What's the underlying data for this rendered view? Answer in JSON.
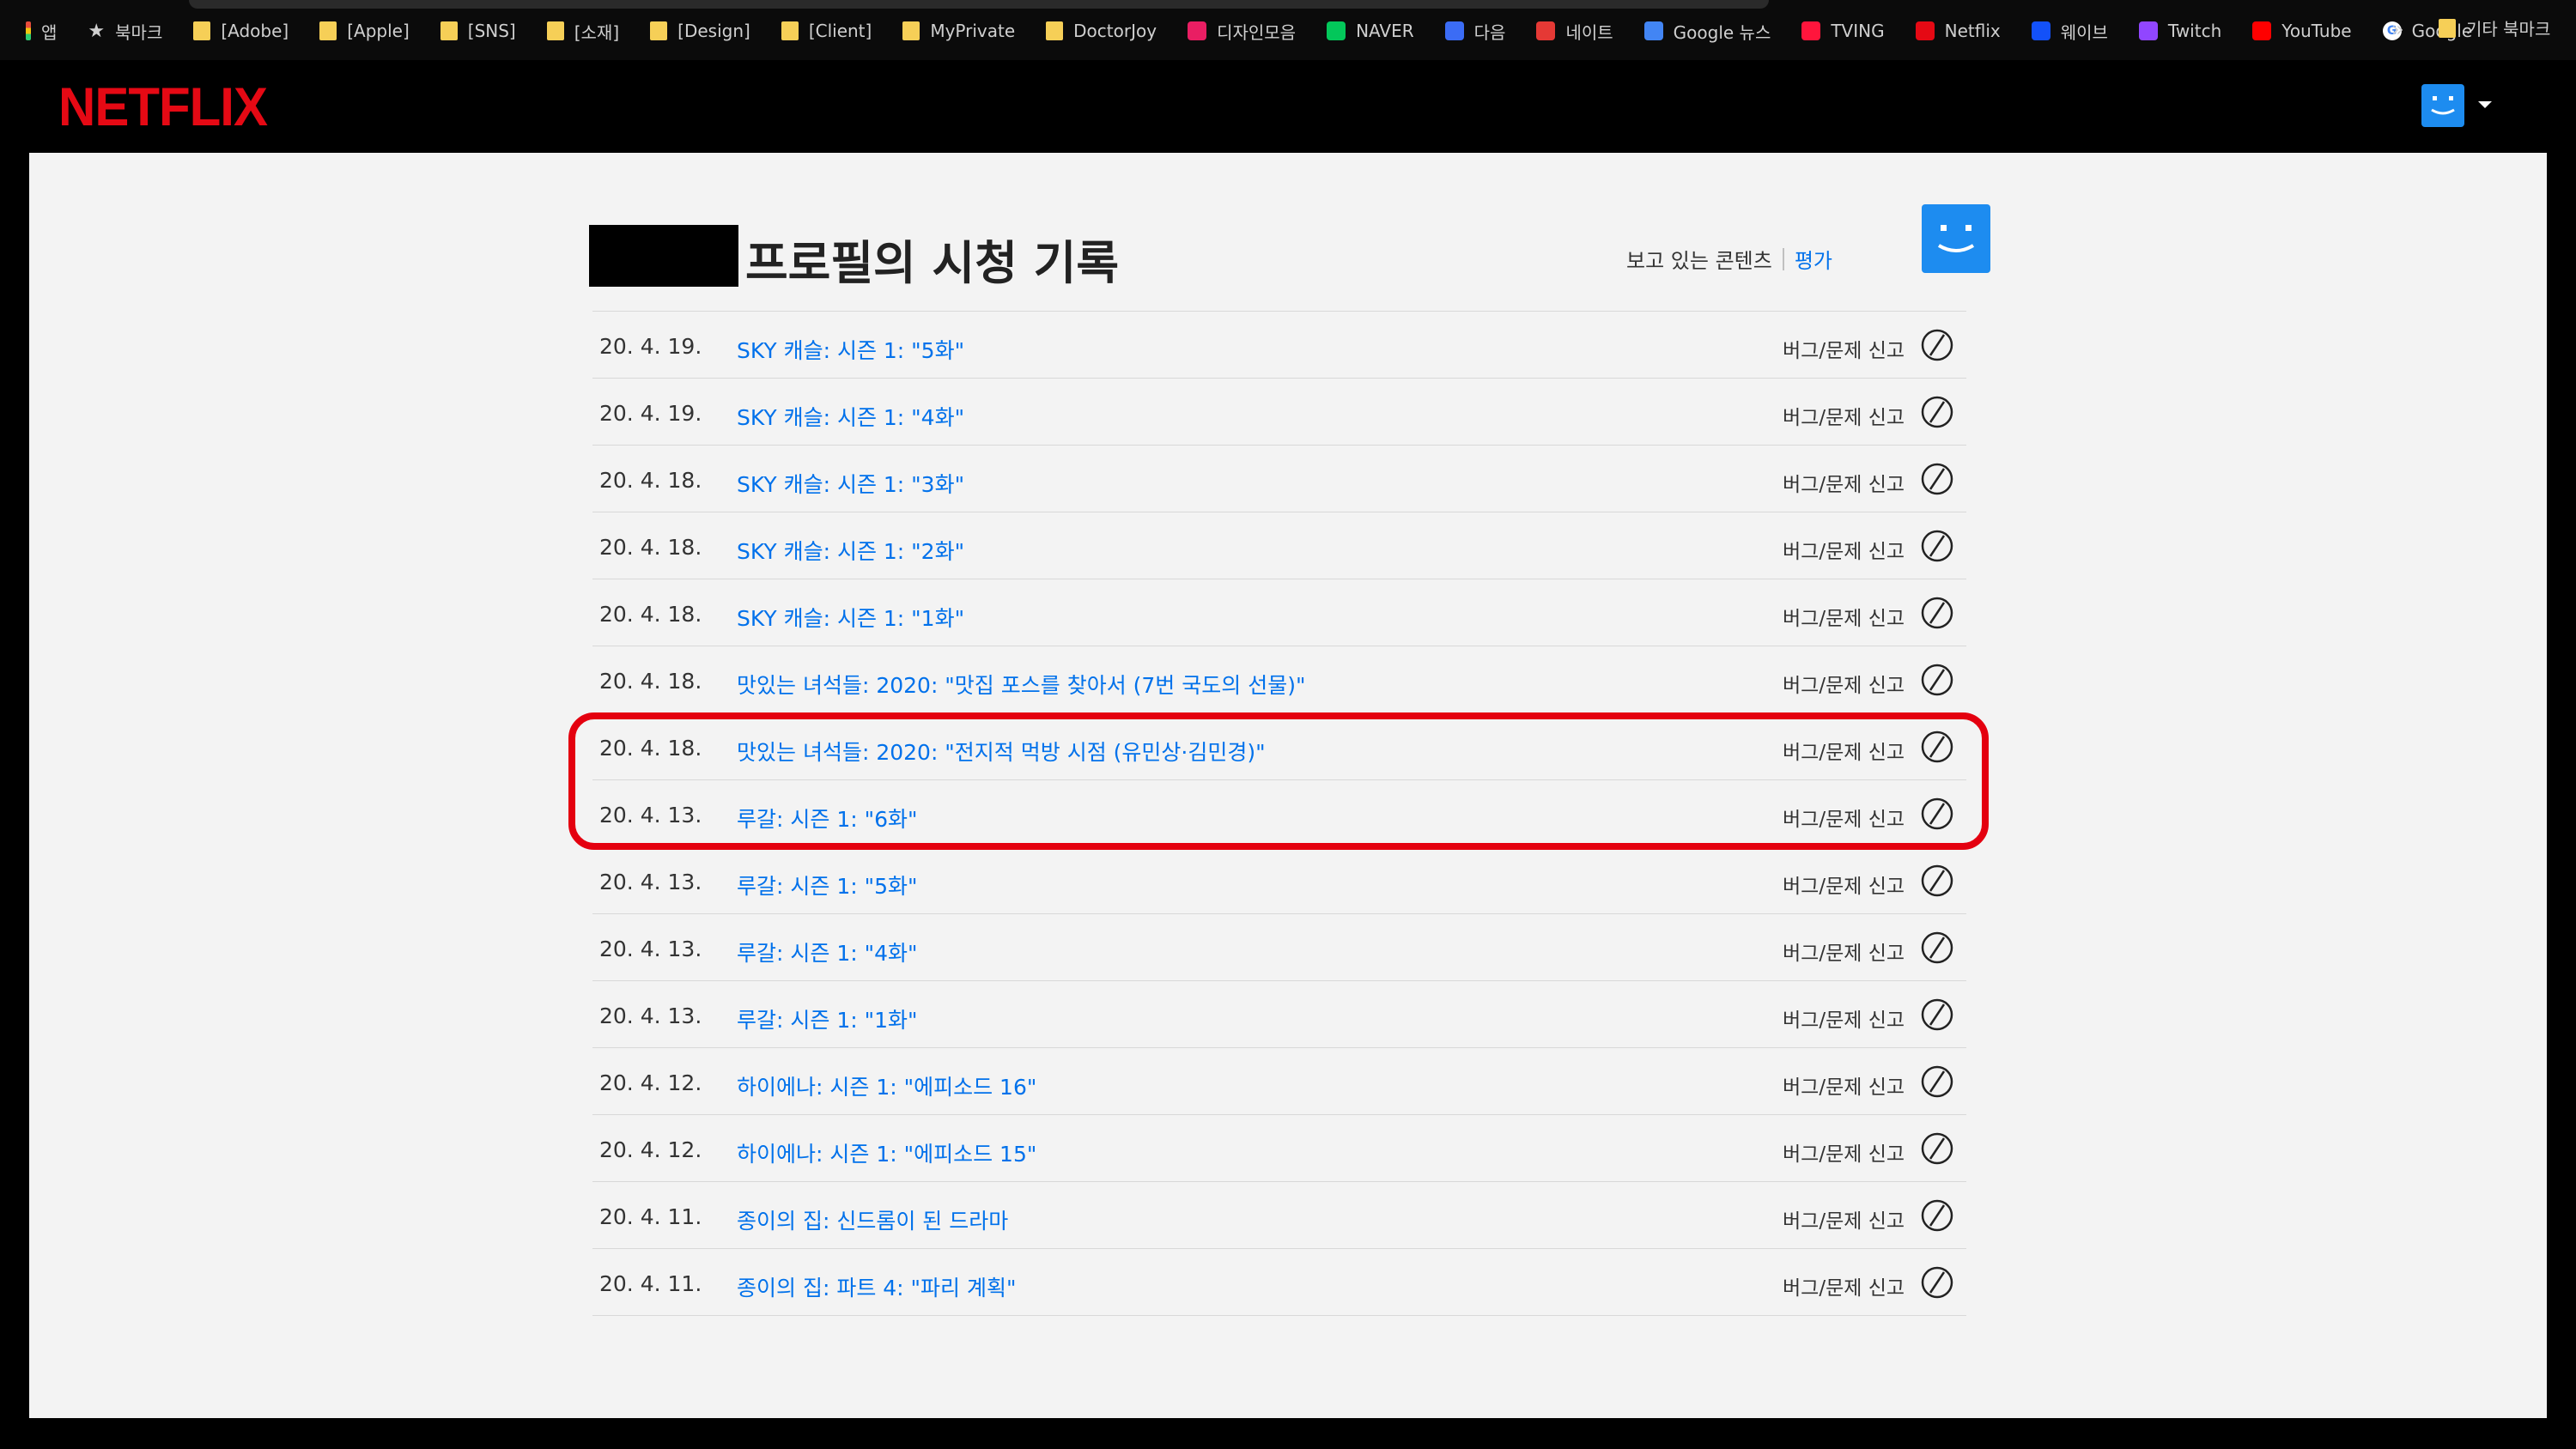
{
  "bookmarks": {
    "items": [
      {
        "label": "앱",
        "icon": "apps-grid-icon"
      },
      {
        "label": "북마크",
        "icon": "star-icon"
      },
      {
        "label": "[Adobe]",
        "icon": "folder-icon"
      },
      {
        "label": "[Apple]",
        "icon": "folder-icon"
      },
      {
        "label": "[SNS]",
        "icon": "folder-icon"
      },
      {
        "label": "[소재]",
        "icon": "folder-icon"
      },
      {
        "label": "[Design]",
        "icon": "folder-icon"
      },
      {
        "label": "[Client]",
        "icon": "folder-icon"
      },
      {
        "label": "MyPrivate",
        "icon": "folder-icon"
      },
      {
        "label": "DoctorJoy",
        "icon": "folder-icon"
      },
      {
        "label": "디자인모음",
        "icon": "site-icon",
        "color": "#e91e63"
      },
      {
        "label": "NAVER",
        "icon": "naver-icon",
        "color": "#03c75a"
      },
      {
        "label": "다음",
        "icon": "daum-icon",
        "color": "#3b6cf5"
      },
      {
        "label": "네이트",
        "icon": "nate-icon",
        "color": "#e53935"
      },
      {
        "label": "Google 뉴스",
        "icon": "google-news-icon",
        "color": "#4285f4"
      },
      {
        "label": "TVING",
        "icon": "tving-icon",
        "color": "#ff153c"
      },
      {
        "label": "Netflix",
        "icon": "netflix-icon",
        "color": "#e50914"
      },
      {
        "label": "웨이브",
        "icon": "wavve-icon",
        "color": "#1351f9"
      },
      {
        "label": "Twitch",
        "icon": "twitch-icon",
        "color": "#9146ff"
      },
      {
        "label": "YouTube",
        "icon": "youtube-icon",
        "color": "#ff0000"
      },
      {
        "label": "Google",
        "icon": "google-icon",
        "color": "#ffffff"
      }
    ],
    "overflow_label": "»",
    "other_label": "기타 북마크"
  },
  "header": {
    "logo": "NETFLIX",
    "brand_color": "#e50914",
    "avatar_color": "#1d8cf0"
  },
  "page": {
    "title": "프로필의 시청 기록",
    "nav_watching": "보고 있는 콘텐츠",
    "nav_rating": "평가",
    "link_color": "#0071eb"
  },
  "history": {
    "report_label": "버그/문제 신고",
    "hide_icon": "hide-from-history-icon",
    "rows": [
      {
        "date": "20. 4. 19.",
        "title": "SKY 캐슬: 시즌 1: \"5화\""
      },
      {
        "date": "20. 4. 19.",
        "title": "SKY 캐슬: 시즌 1: \"4화\""
      },
      {
        "date": "20. 4. 18.",
        "title": "SKY 캐슬: 시즌 1: \"3화\""
      },
      {
        "date": "20. 4. 18.",
        "title": "SKY 캐슬: 시즌 1: \"2화\""
      },
      {
        "date": "20. 4. 18.",
        "title": "SKY 캐슬: 시즌 1: \"1화\""
      },
      {
        "date": "20. 4. 18.",
        "title": "맛있는 녀석들: 2020: \"맛집 포스를 찾아서 (7번 국도의 선물)\""
      },
      {
        "date": "20. 4. 18.",
        "title": "맛있는 녀석들: 2020: \"전지적 먹방 시점 (유민상·김민경)\""
      },
      {
        "date": "20. 4. 13.",
        "title": "루갈: 시즌 1: \"6화\""
      },
      {
        "date": "20. 4. 13.",
        "title": "루갈: 시즌 1: \"5화\""
      },
      {
        "date": "20. 4. 13.",
        "title": "루갈: 시즌 1: \"4화\""
      },
      {
        "date": "20. 4. 13.",
        "title": "루갈: 시즌 1: \"1화\""
      },
      {
        "date": "20. 4. 12.",
        "title": "하이에나: 시즌 1: \"에피소드 16\""
      },
      {
        "date": "20. 4. 12.",
        "title": "하이에나: 시즌 1: \"에피소드 15\""
      },
      {
        "date": "20. 4. 11.",
        "title": "종이의 집: 신드롬이 된 드라마"
      },
      {
        "date": "20. 4. 11.",
        "title": "종이의 집: 파트 4: \"파리 계획\""
      }
    ]
  },
  "annotation": {
    "highlight_color": "#e4000f"
  }
}
